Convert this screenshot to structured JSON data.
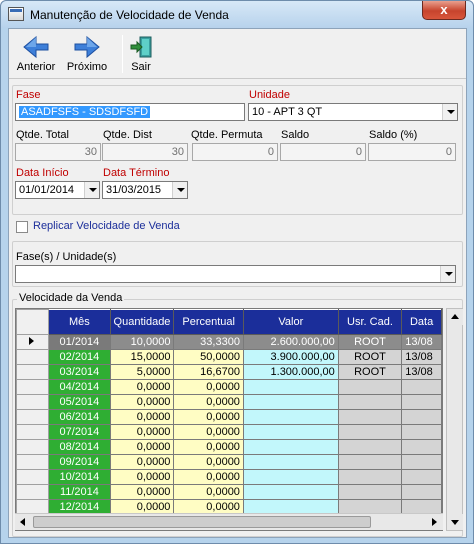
{
  "window": {
    "title": "Manutenção de Velocidade de Venda",
    "close_glyph": "x"
  },
  "toolbar": {
    "prev_label": "Anterior",
    "next_label": "Próximo",
    "exit_label": "Sair"
  },
  "form": {
    "fase": {
      "label": "Fase",
      "value": "ASADFSFS - SDSDFSFD"
    },
    "unidade": {
      "label": "Unidade",
      "value": "10 - APT 3 QT"
    },
    "qtde_total": {
      "label": "Qtde. Total",
      "value": "30"
    },
    "qtde_dist": {
      "label": "Qtde. Dist",
      "value": "30"
    },
    "qtde_permuta": {
      "label": "Qtde. Permuta",
      "value": "0"
    },
    "saldo": {
      "label": "Saldo",
      "value": "0"
    },
    "saldo_pct": {
      "label": "Saldo (%)",
      "value": "0"
    },
    "data_inicio": {
      "label": "Data Início",
      "value": "01/01/2014"
    },
    "data_termino": {
      "label": "Data Término",
      "value": "31/03/2015"
    },
    "replicar": {
      "label": "Replicar Velocidade de Venda",
      "checked": false
    },
    "fases_unidades": {
      "label": "Fase(s) / Unidade(s)",
      "value": ""
    }
  },
  "grid": {
    "group_label": "Velocidade da Venda",
    "columns": [
      "Mês",
      "Quantidade",
      "Percentual",
      "Valor",
      "Usr. Cad.",
      "Data"
    ],
    "rows": [
      {
        "mes": "01/2014",
        "qtd": "10,0000",
        "pct": "33,3300",
        "valor": "2.600.000,00",
        "usr": "ROOT",
        "data": "13/08"
      },
      {
        "mes": "02/2014",
        "qtd": "15,0000",
        "pct": "50,0000",
        "valor": "3.900.000,00",
        "usr": "ROOT",
        "data": "13/08"
      },
      {
        "mes": "03/2014",
        "qtd": "5,0000",
        "pct": "16,6700",
        "valor": "1.300.000,00",
        "usr": "ROOT",
        "data": "13/08"
      },
      {
        "mes": "04/2014",
        "qtd": "0,0000",
        "pct": "0,0000",
        "valor": "",
        "usr": "",
        "data": ""
      },
      {
        "mes": "05/2014",
        "qtd": "0,0000",
        "pct": "0,0000",
        "valor": "",
        "usr": "",
        "data": ""
      },
      {
        "mes": "06/2014",
        "qtd": "0,0000",
        "pct": "0,0000",
        "valor": "",
        "usr": "",
        "data": ""
      },
      {
        "mes": "07/2014",
        "qtd": "0,0000",
        "pct": "0,0000",
        "valor": "",
        "usr": "",
        "data": ""
      },
      {
        "mes": "08/2014",
        "qtd": "0,0000",
        "pct": "0,0000",
        "valor": "",
        "usr": "",
        "data": ""
      },
      {
        "mes": "09/2014",
        "qtd": "0,0000",
        "pct": "0,0000",
        "valor": "",
        "usr": "",
        "data": ""
      },
      {
        "mes": "10/2014",
        "qtd": "0,0000",
        "pct": "0,0000",
        "valor": "",
        "usr": "",
        "data": ""
      },
      {
        "mes": "11/2014",
        "qtd": "0,0000",
        "pct": "0,0000",
        "valor": "",
        "usr": "",
        "data": ""
      },
      {
        "mes": "12/2014",
        "qtd": "0,0000",
        "pct": "0,0000",
        "valor": "",
        "usr": "",
        "data": ""
      }
    ]
  },
  "colors": {
    "title_accent": "#1b2e9a",
    "month_cell": "#2fae33",
    "qty_cell": "#fffdc4",
    "value_cell": "#c2f7fb",
    "selection": "#3399ff"
  }
}
